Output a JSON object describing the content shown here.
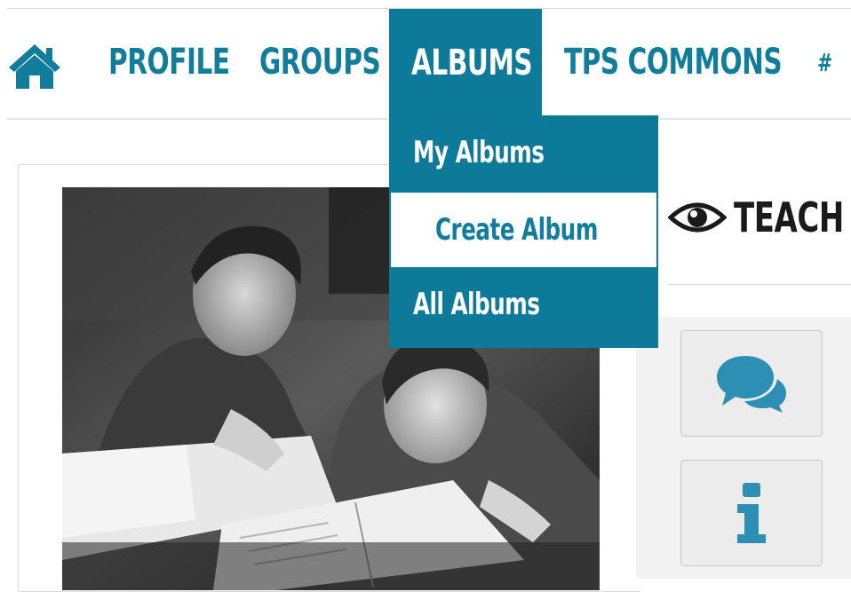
{
  "nav": {
    "home_icon": "home-icon",
    "profile": "PROFILE",
    "groups": "GROUPS",
    "albums": "ALBUMS",
    "commons": "TPS COMMONS",
    "hash": "#"
  },
  "albums_menu": {
    "my_albums": "My Albums",
    "create_album": "Create Album",
    "all_albums": "All Albums"
  },
  "page": {
    "title": "TEACH",
    "title_icon": "eye-icon"
  },
  "tools": {
    "comments_icon": "comments-icon",
    "info_icon": "info-icon"
  },
  "colors": {
    "brand": "#0e7a9a",
    "nav_text": "#117d9c",
    "tool_icon": "#2e8fb5"
  }
}
